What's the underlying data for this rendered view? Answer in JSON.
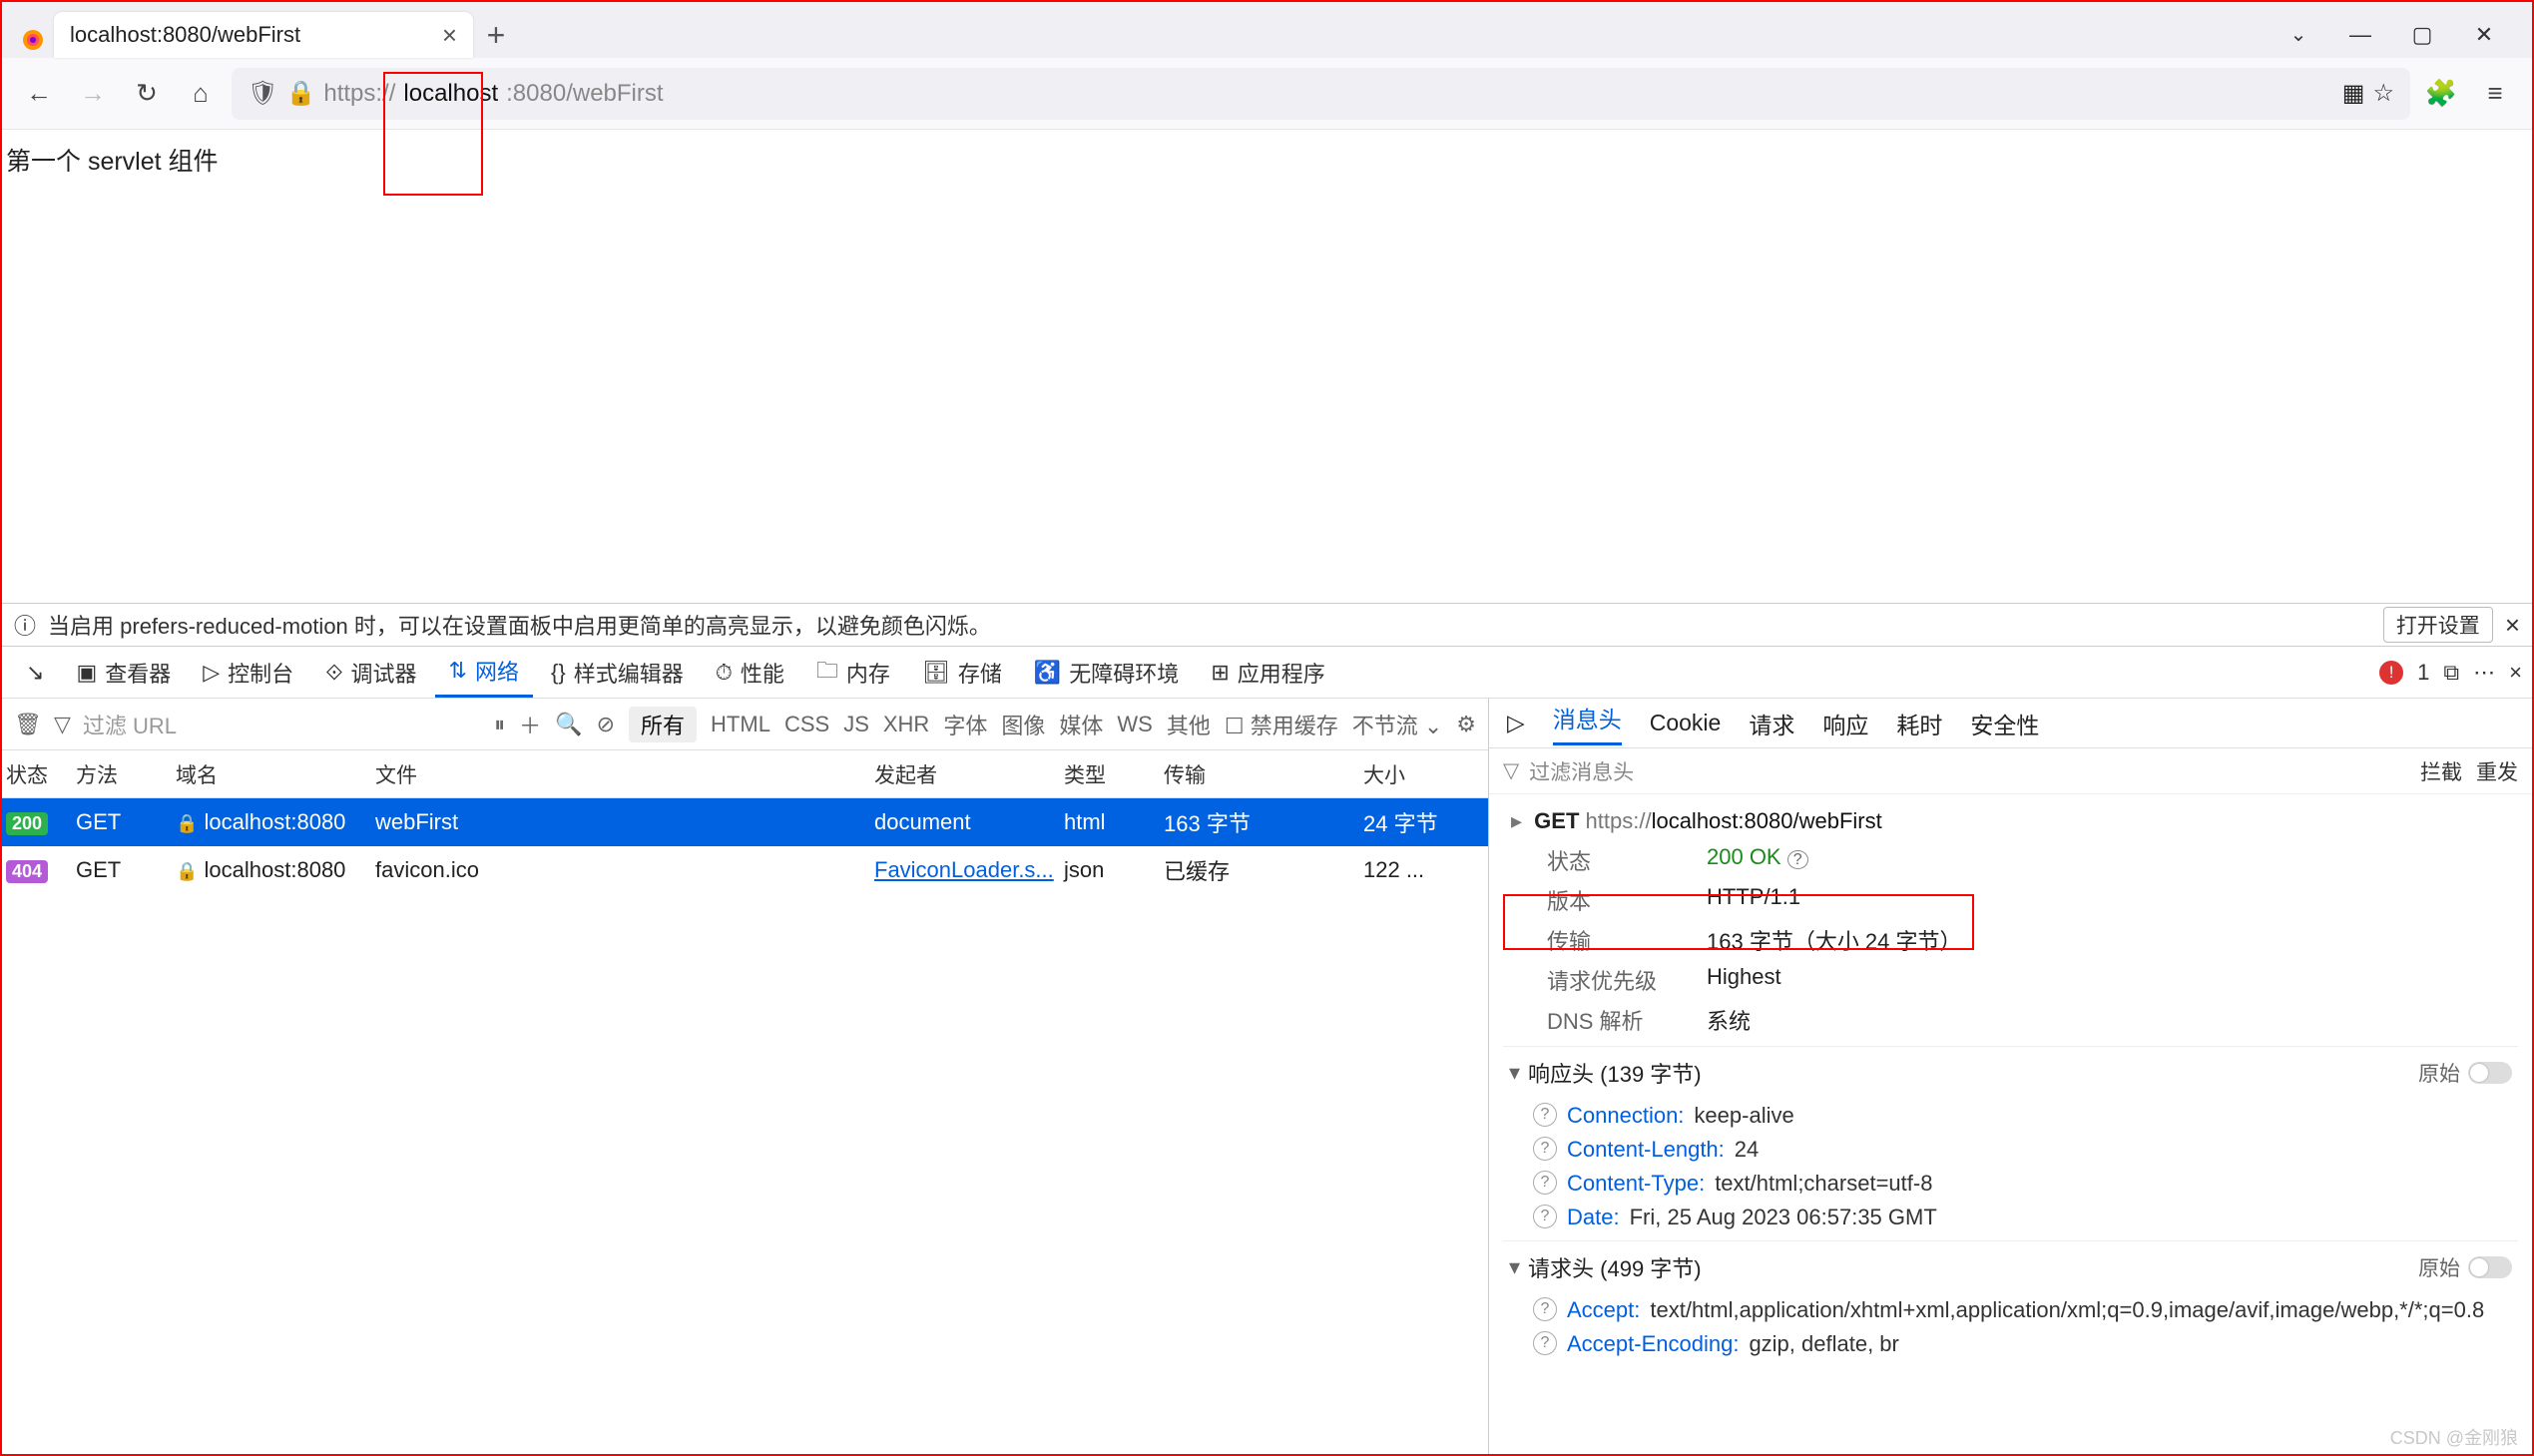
{
  "tab": {
    "title": "localhost:8080/webFirst"
  },
  "url": {
    "scheme": "https://",
    "host": "localhost",
    "rest": ":8080/webFirst"
  },
  "page": {
    "content": "第一个 servlet 组件"
  },
  "infoBar": {
    "text": "当启用 prefers-reduced-motion 时，可以在设置面板中启用更简单的高亮显示，以避免颜色闪烁。",
    "openSettings": "打开设置"
  },
  "devtoolsTabs": {
    "inspector": "查看器",
    "console": "控制台",
    "debugger": "调试器",
    "network": "网络",
    "style": "样式编辑器",
    "perf": "性能",
    "memory": "内存",
    "storage": "存储",
    "a11y": "无障碍环境",
    "apps": "应用程序",
    "errCount": "1"
  },
  "netFilters": {
    "all": "所有",
    "html": "HTML",
    "css": "CSS",
    "js": "JS",
    "xhr": "XHR",
    "fonts": "字体",
    "images": "图像",
    "media": "媒体",
    "ws": "WS",
    "other": "其他",
    "disableCache": "禁用缓存",
    "throttle": "不节流",
    "filterUrl": "过滤 URL"
  },
  "netCols": {
    "status": "状态",
    "method": "方法",
    "domain": "域名",
    "file": "文件",
    "initiator": "发起者",
    "type": "类型",
    "transfer": "传输",
    "size": "大小"
  },
  "rows": [
    {
      "status": "200",
      "statusClass": "status-200",
      "method": "GET",
      "domain": "localhost:8080",
      "file": "webFirst",
      "initiator": "document",
      "type": "html",
      "transfer": "163 字节",
      "size": "24 字节",
      "selected": true,
      "lockColor": "#e5f0ff"
    },
    {
      "status": "404",
      "statusClass": "status-404",
      "method": "GET",
      "domain": "localhost:8080",
      "file": "favicon.ico",
      "initiator": "FaviconLoader.s...",
      "initiatorLink": true,
      "type": "json",
      "transfer": "已缓存",
      "size": "122 ...",
      "selected": false,
      "lockColor": "#999"
    }
  ],
  "detail": {
    "subtabs": {
      "headers": "消息头",
      "cookie": "Cookie",
      "request": "请求",
      "response": "响应",
      "timing": "耗时",
      "security": "安全性"
    },
    "filterPlaceholder": "过滤消息头",
    "block": "拦截",
    "resend": "重发",
    "reqLine": {
      "method": "GET",
      "scheme": "https://",
      "host": "localhost:8080",
      "path": "/webFirst"
    },
    "summary": [
      {
        "k": "状态",
        "v": "200 OK",
        "green": true,
        "q": true
      },
      {
        "k": "版本",
        "v": "HTTP/1.1"
      },
      {
        "k": "传输",
        "v": "163 字节（大小 24 字节）"
      },
      {
        "k": "请求优先级",
        "v": "Highest"
      },
      {
        "k": "DNS 解析",
        "v": "系统"
      }
    ],
    "respHead": "响应头 (139 字节)",
    "reqHead": "请求头 (499 字节)",
    "raw": "原始",
    "respHeaders": [
      {
        "k": "Connection:",
        "v": "keep-alive"
      },
      {
        "k": "Content-Length:",
        "v": "24"
      },
      {
        "k": "Content-Type:",
        "v": "text/html;charset=utf-8"
      },
      {
        "k": "Date:",
        "v": "Fri, 25 Aug 2023 06:57:35 GMT"
      }
    ],
    "reqHeaders": [
      {
        "k": "Accept:",
        "v": "text/html,application/xhtml+xml,application/xml;q=0.9,image/avif,image/webp,*/*;q=0.8"
      },
      {
        "k": "Accept-Encoding:",
        "v": "gzip, deflate, br"
      }
    ]
  },
  "watermark": "CSDN @金刚狼"
}
